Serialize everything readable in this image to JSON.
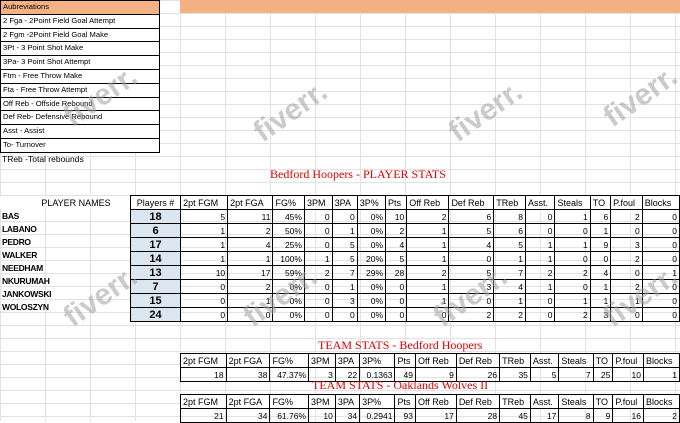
{
  "abbreviations": {
    "header": "Aubreviations",
    "items": [
      "2 Fga - 2Point Field Goal Attempt",
      "2 Fgm -2Point Field Goal Make",
      "3Pt - 3 Point  Shot Make",
      "3Pa- 3 Point Shot Attempt",
      "Ftm - Free Throw Make",
      "Fta - Free Throw Attempt",
      "Off Reb - Offside Rebound",
      "Def Reb- Defensive Rebound",
      "Asst - Assist",
      "To- Turnover"
    ],
    "footer": "TReb -Total rebounds"
  },
  "player_stats": {
    "title": "Bedford Hoopers  - PLAYER STATS",
    "names_header": "PLAYER NAMES",
    "headers": [
      "Players #",
      "2pt FGM",
      "2pt FGA",
      "FG%",
      "3PM",
      "3PA",
      "3P%",
      "Pts",
      "Off Reb",
      "Def Reb",
      "TReb",
      "Asst.",
      "Steals",
      "TO",
      "P.foul",
      "Blocks"
    ],
    "rows": [
      {
        "name": "BAS",
        "cells": [
          "18",
          "5",
          "11",
          "45%",
          "0",
          "0",
          "0%",
          "10",
          "2",
          "6",
          "8",
          "0",
          "1",
          "6",
          "2",
          "0"
        ]
      },
      {
        "name": "LABANO",
        "cells": [
          "6",
          "1",
          "2",
          "50%",
          "0",
          "1",
          "0%",
          "2",
          "1",
          "5",
          "6",
          "0",
          "0",
          "1",
          "0",
          "0"
        ]
      },
      {
        "name": "PEDRO",
        "cells": [
          "17",
          "1",
          "4",
          "25%",
          "0",
          "5",
          "0%",
          "4",
          "1",
          "4",
          "5",
          "1",
          "1",
          "9",
          "3",
          "0"
        ]
      },
      {
        "name": "WALKER",
        "cells": [
          "14",
          "1",
          "1",
          "100%",
          "1",
          "5",
          "20%",
          "5",
          "1",
          "0",
          "1",
          "1",
          "0",
          "0",
          "2",
          "0"
        ]
      },
      {
        "name": "NEEDHAM",
        "cells": [
          "13",
          "10",
          "17",
          "59%",
          "2",
          "7",
          "29%",
          "28",
          "2",
          "5",
          "7",
          "2",
          "2",
          "4",
          "0",
          "1"
        ]
      },
      {
        "name": "NKURUMAH",
        "cells": [
          "7",
          "0",
          "2",
          "0%",
          "0",
          "1",
          "0%",
          "0",
          "1",
          "3",
          "4",
          "1",
          "0",
          "1",
          "2",
          "0"
        ]
      },
      {
        "name": "JANKOWSKI",
        "cells": [
          "15",
          "0",
          "1",
          "0%",
          "0",
          "3",
          "0%",
          "0",
          "1",
          "0",
          "1",
          "0",
          "1",
          "1",
          "1",
          "0"
        ]
      },
      {
        "name": "WOLOSZYN",
        "cells": [
          "24",
          "0",
          "0",
          "0%",
          "0",
          "0",
          "0%",
          "0",
          "0",
          "2",
          "2",
          "0",
          "2",
          "3",
          "0",
          "0"
        ]
      }
    ]
  },
  "team_bedford": {
    "title": "TEAM STATS  - Bedford Hoopers",
    "headers": [
      "2pt FGM",
      "2pt FGA",
      "FG%",
      "3PM",
      "3PA",
      "3P%",
      "Pts",
      "Off Reb",
      "Def Reb",
      "TReb",
      "Asst.",
      "Steals",
      "TO",
      "P.foul",
      "Blocks"
    ],
    "values": [
      "18",
      "38",
      "47.37%",
      "3",
      "22",
      "0.1363",
      "49",
      "9",
      "26",
      "35",
      "5",
      "7",
      "25",
      "10",
      "1"
    ]
  },
  "team_oaklands": {
    "title": "TEAM STATS  - Oaklands Wolves II",
    "headers": [
      "2pt FGM",
      "2pt FGA",
      "FG%",
      "3PM",
      "3PA",
      "3P%",
      "Pts",
      "Off Reb",
      "Def Reb",
      "TReb",
      "Asst.",
      "Steals",
      "TO",
      "P.foul",
      "Blocks"
    ],
    "values": [
      "21",
      "34",
      "61.76%",
      "10",
      "34",
      "0.2941",
      "93",
      "17",
      "28",
      "45",
      "17",
      "8",
      "9",
      "16",
      "2"
    ]
  },
  "watermark": "fiverr."
}
